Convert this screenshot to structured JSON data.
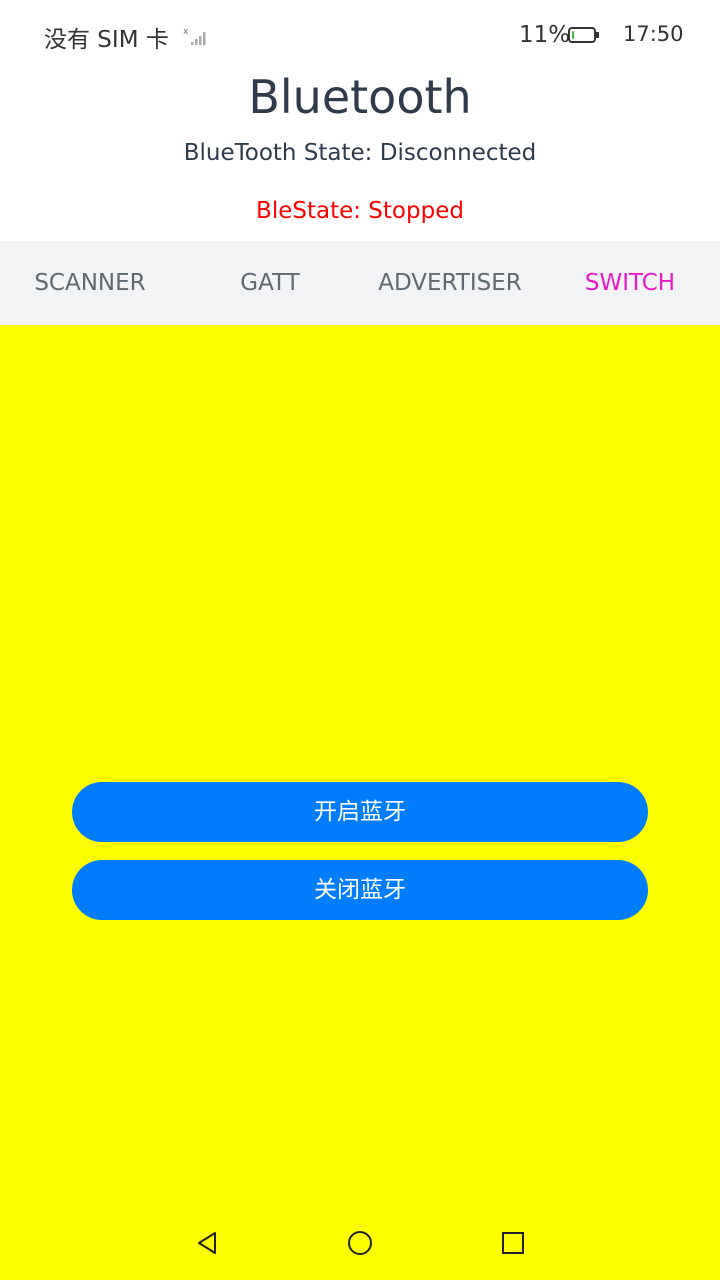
{
  "status_bar": {
    "carrier": "没有 SIM 卡",
    "battery_percent": "11%",
    "battery_level": 0.11,
    "time": "17:50"
  },
  "header": {
    "title": "Bluetooth",
    "bluetooth_state": "BlueTooth State: Disconnected",
    "ble_state": "BleState: Stopped"
  },
  "tabs": [
    {
      "label": "SCANNER",
      "active": false
    },
    {
      "label": "GATT",
      "active": false
    },
    {
      "label": "ADVERTISER",
      "active": false
    },
    {
      "label": "SWITCH",
      "active": true
    }
  ],
  "actions": {
    "enable_label": "开启蓝牙",
    "disable_label": "关闭蓝牙"
  },
  "colors": {
    "active_tab": "#e919c8",
    "ble_state": "#ff0000",
    "button": "#007dff",
    "content_bg": "#ffff00",
    "tabbar_bg": "#f1f3f5"
  },
  "nav_bar": {
    "icons": [
      "back-triangle-icon",
      "home-circle-icon",
      "recents-square-icon"
    ]
  }
}
